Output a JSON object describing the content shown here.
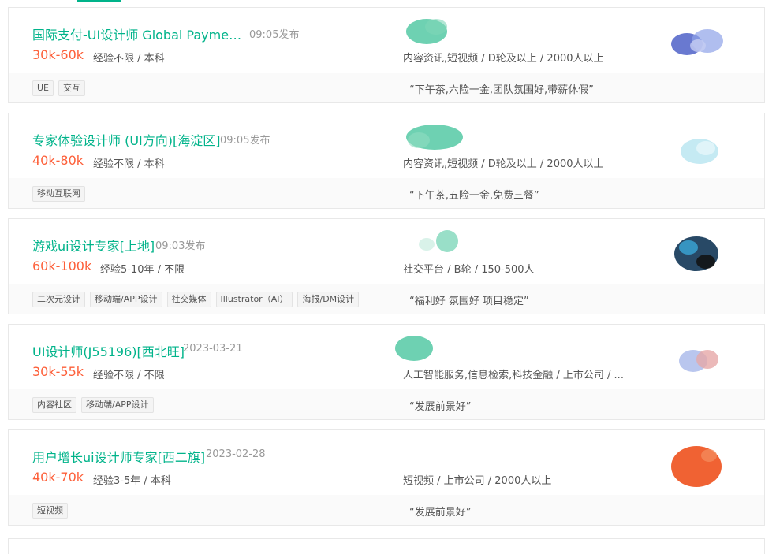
{
  "jobs": [
    {
      "title": "国际支付-UI设计师 Global Paymen...",
      "time": "09:05发布",
      "salary": "30k-60k",
      "req": "经验不限 / 本科",
      "company_info": "内容资讯,短视频 / D轮及以上 / 2000人以上",
      "tags": [
        "UE",
        "交互"
      ],
      "benefit": "“下午茶,六险一金,团队氛围好,带薪休假”",
      "logo_color": "#6a7fd6"
    },
    {
      "title": "专家体验设计师 (UI方向)[海淀区]",
      "time": "09:05发布",
      "salary": "40k-80k",
      "req": "经验不限 / 本科",
      "company_info": "内容资讯,短视频 / D轮及以上 / 2000人以上",
      "tags": [
        "移动互联网"
      ],
      "benefit": "“下午茶,五险一金,免费三餐”",
      "logo_color": "#bfe8f2"
    },
    {
      "title": "游戏ui设计专家[上地]",
      "time": "09:03发布",
      "salary": "60k-100k",
      "req": "经验5-10年 / 不限",
      "company_info": "社交平台 / B轮 / 150-500人",
      "tags": [
        "二次元设计",
        "移动端/APP设计",
        "社交媒体",
        "Illustrator（AI）",
        "海报/DM设计"
      ],
      "benefit": "“福利好 氛围好 项目稳定”",
      "logo_color": "#1c3f5e"
    },
    {
      "title": "UI设计师(J55196)[西北旺]",
      "time": "2023-03-21",
      "salary": "30k-55k",
      "req": "经验不限 / 不限",
      "company_info": "人工智能服务,信息检索,科技金融 / 上市公司 / ...",
      "tags": [
        "内容社区",
        "移动端/APP设计"
      ],
      "benefit": "“发展前景好”",
      "logo_color": "#c9b8d8"
    },
    {
      "title": "用户增长ui设计师专家[西二旗]",
      "time": "2023-02-28",
      "salary": "40k-70k",
      "req": "经验3-5年 / 本科",
      "company_info": "短视频 / 上市公司 / 2000人以上",
      "tags": [
        "短视频"
      ],
      "benefit": "“发展前景好”",
      "logo_color": "#ef5a28"
    }
  ],
  "colors": {
    "accent": "#00b38a",
    "salary": "#fd5f39",
    "blob": "#55c9a4"
  }
}
